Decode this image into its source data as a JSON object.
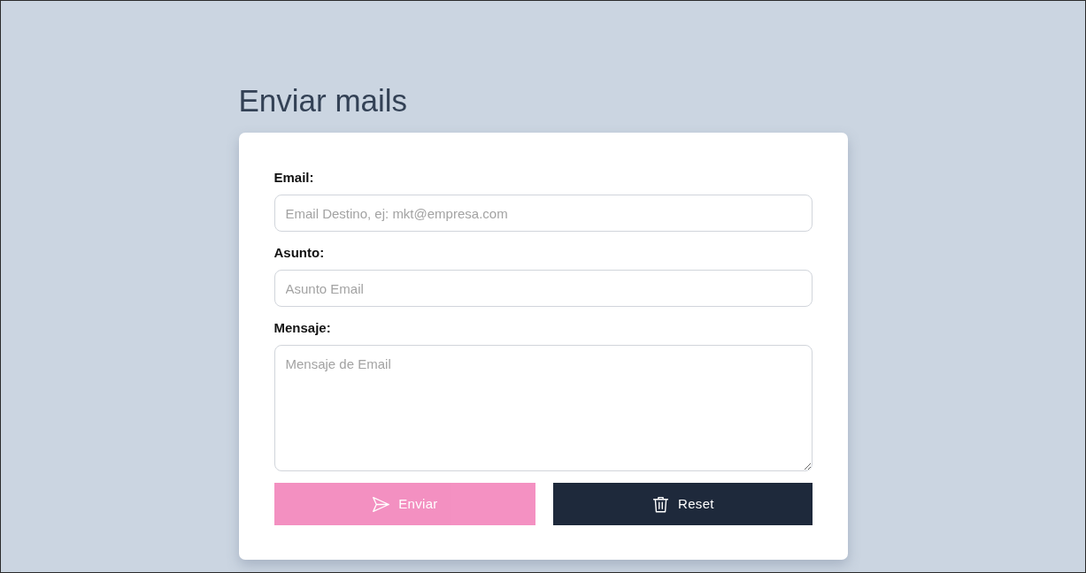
{
  "page": {
    "title": "Enviar mails"
  },
  "form": {
    "fields": [
      {
        "kind": "input",
        "label": "Email:",
        "placeholder": "Email Destino, ej: mkt@empresa.com"
      },
      {
        "kind": "input",
        "label": "Asunto:",
        "placeholder": "Asunto Email"
      },
      {
        "kind": "textarea",
        "label": "Mensaje:",
        "placeholder": "Mensaje de Email"
      }
    ],
    "buttons": [
      {
        "kind": "send",
        "label": "Enviar",
        "disabled": true
      },
      {
        "kind": "reset",
        "label": "Reset",
        "disabled": false
      }
    ]
  }
}
